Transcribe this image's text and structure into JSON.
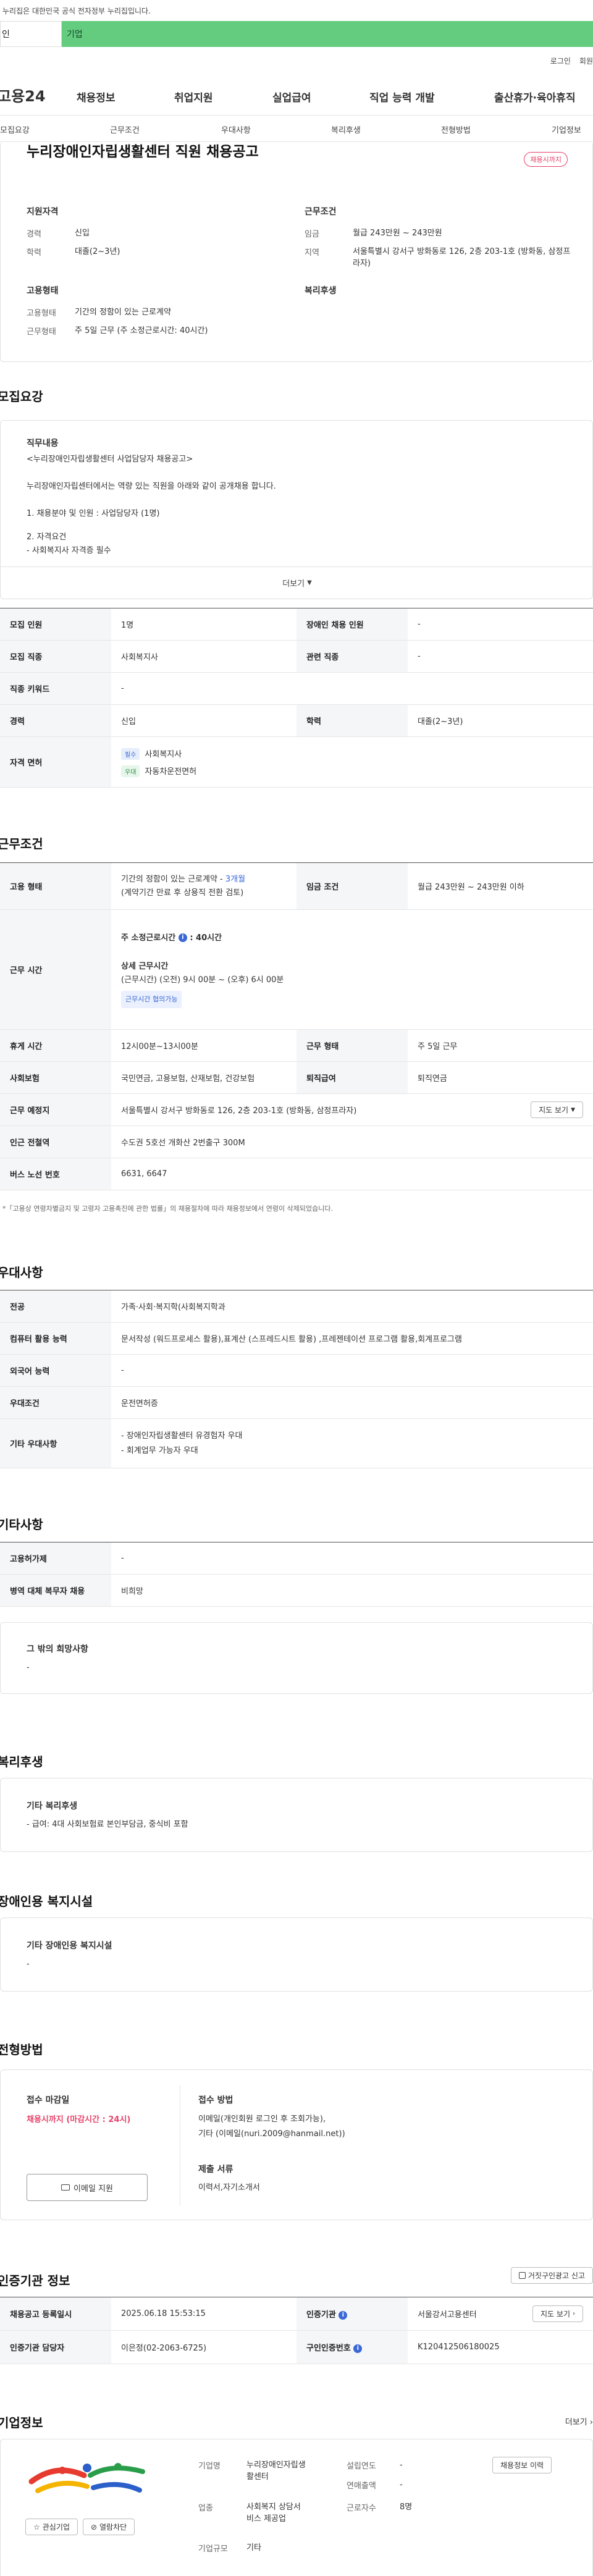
{
  "gov_bar": {
    "text": "누리집은 대한민국 공식 전자정부 누리집입니다."
  },
  "tabs": [
    {
      "label": "인"
    },
    {
      "label": "기업"
    }
  ],
  "util": {
    "login": "로그인",
    "join": "회원"
  },
  "gnb": {
    "logo": "고용24",
    "menus": [
      "채용정보",
      "취업지원",
      "실업급여",
      "직업 능력 개발",
      "출산휴가·육아휴직"
    ]
  },
  "subnav": [
    "모집요강",
    "근무조건",
    "우대사항",
    "복리후생",
    "전형방법",
    "기업정보"
  ],
  "summary": {
    "title": "누리장애인자립생활센터 직원 채용공고",
    "badge": "채용시까지",
    "qual_h": "지원자격",
    "career_k": "경력",
    "career_v": "신입",
    "edu_k": "학력",
    "edu_v": "대졸(2~3년)",
    "cond_h": "근무조건",
    "wage_k": "임금",
    "wage_v": "월급 243만원 ~ 243만원",
    "region_k": "지역",
    "region_v": "서울특별시 강서구 방화동로 126, 2층 203-1호 (방화동, 삼정프라자)",
    "emp_h": "고용형태",
    "emptype_k": "고용형태",
    "emptype_v": "기간의 정함이 있는 근로계약",
    "worktype_k": "근무형태",
    "worktype_v": "주 5일 근무 (주 소정근로시간: 40시간)",
    "welfare_h": "복리후생"
  },
  "recruit": {
    "title": "모집요강",
    "duty_h": "직무내용",
    "lines": [
      "<누리장애인자립생활센터 사업담당자 채용공고>",
      "",
      "누리장애인자립센터에서는 역량 있는 직원을 아래와 같이 공개채용 합니다.",
      "",
      "1. 채용분야 및 인원 : 사업담당자 (1명)",
      "",
      "2. 자격요건",
      "- 사회복지사 자격증 필수"
    ],
    "more": "더보기",
    "rows": [
      {
        "k1": "모집 인원",
        "v1": "1명",
        "k2": "장애인 채용 인원",
        "v2": "-"
      },
      {
        "k1": "모집 직종",
        "v1": "사회복지사",
        "k2": "관련 직종",
        "v2": "-"
      },
      {
        "k1": "직종 키워드",
        "v1": "-"
      },
      {
        "k1": "경력",
        "v1": "신입",
        "k2": "학력",
        "v2": "대졸(2~3년)"
      }
    ],
    "license_k": "자격 면허",
    "licenses": [
      {
        "tag": "필수",
        "name": "사회복지사"
      },
      {
        "tag": "우대",
        "name": "자동차운전면허"
      }
    ]
  },
  "work": {
    "title": "근무조건",
    "emp_k": "고용 형태",
    "emp_v1": "기간의 정함이 있는 근로계약 - ",
    "emp_v1b": "3개월",
    "emp_v2": "(계약기간 만료 후 상용직 전환 검토)",
    "wage_k": "임금 조건",
    "wage_v": "월급 243만원 ~ 243만원 이하",
    "hours_k": "근무 시간",
    "hours_total": "주 소정근로시간",
    "hours_total_v": ": 40시간",
    "hours_detail_h": "상세 근무시간",
    "hours_detail_v": "(근무시간) (오전) 9시 00분 ~ (오후) 6시 00분",
    "hours_tag": "근무시간 협의가능",
    "rows": [
      {
        "k1": "휴게 시간",
        "v1": "12시00분~13시00분",
        "k2": "근무 형태",
        "v2": "주 5일 근무"
      },
      {
        "k1": "사회보험",
        "v1": "국민연금, 고용보험, 산재보험, 건강보험",
        "k2": "퇴직급여",
        "v2": "퇴직연금"
      }
    ],
    "place_k": "근무 예정지",
    "place_v": "서울특별시 강서구 방화동로 126, 2층 203-1호 (방화동, 삼정프라자)",
    "map_btn": "지도 보기",
    "subway_k": "인근 전철역",
    "subway_v": "수도권 5호선 개화산 2번출구 300M",
    "bus_k": "버스 노선 번호",
    "bus_v": "6631, 6647",
    "note": "*「고용상 연령차별금지 및 고령자 고용촉진에 관한 법률」의 채용절차에 따라 채용정보에서 연령이 삭제되었습니다."
  },
  "pref": {
    "title": "우대사항",
    "rows": [
      {
        "k": "전공",
        "v": "가족·사회·복지학(사회복지학과"
      },
      {
        "k": "컴퓨터 활용 능력",
        "v": "문서작성 (워드프로세스 활용),표계산 (스프레드시트 활용) ,프레젠테이션 프로그램 활용,회계프로그램"
      },
      {
        "k": "외국어 능력",
        "v": "-"
      },
      {
        "k": "우대조건",
        "v": "운전면허증"
      }
    ],
    "etc_k": "기타 우대사항",
    "etc_v": [
      "- 장애인자립생활센터 유경험자 우대",
      "- 회계업무 가능자 우대"
    ]
  },
  "other": {
    "title": "기타사항",
    "rows": [
      {
        "k": "고용허가제",
        "v": "-"
      },
      {
        "k": "병역 대체 복무자 채용",
        "v": "비희망"
      }
    ],
    "wish_h": "그 밖의 희망사항",
    "wish_v": "-"
  },
  "welfare": {
    "title": "복리후생",
    "h": "기타 복리후생",
    "v": "- 급여: 4대 사회보험료 본인부담금, 중식비 포함"
  },
  "disabled": {
    "title": "장애인용 복지시설",
    "h": "기타 장애인용 복지시설",
    "v": "-"
  },
  "selection": {
    "title": "전형방법",
    "deadline_h": "접수 마감일",
    "deadline_v": "채용시까지 (마감시간 : 24시)",
    "email_btn": "이메일 지원",
    "method_h": "접수 방법",
    "method_v1": "이메일(개인회원 로그인 후 조회가능),",
    "method_v2": "기타 (이메일(nuri.2009@hanmail.net))",
    "docs_h": "제출 서류",
    "docs_v": "이력서,자기소개서"
  },
  "cert": {
    "title": "인증기관 정보",
    "report_btn": "거짓구인광고 신고",
    "reg_k": "채용공고 등록일시",
    "reg_v": "2025.06.18 15:53:15",
    "org_k": "인증기관",
    "org_v": "서울강서고용센터",
    "map_btn": "지도 보기",
    "mgr_k": "인증기관 담당자",
    "mgr_v": "이은정(02-2063-6725)",
    "id_k": "구인인증번호",
    "id_v": "K120412506180025"
  },
  "company": {
    "title": "기업정보",
    "more": "더보기",
    "name_k": "기업명",
    "name_v1": "누리장애인자립생",
    "name_v2": "활센터",
    "found_k": "설립연도",
    "found_v": "-",
    "sales_k": "연매출액",
    "sales_v": "-",
    "ind_k": "업종",
    "ind_v1": "사회복지 상담서",
    "ind_v2": "비스 제공업",
    "emp_k": "근로자수",
    "emp_v": "8명",
    "scale_k": "기업규모",
    "scale_v": "기타",
    "fav_btn": "관심기업",
    "block_btn": "열람차단",
    "jobs_btn": "채용정보 이력"
  },
  "colors": {
    "green": "#63cc7f",
    "red": "#e8436a",
    "blue": "#3b68d6"
  }
}
